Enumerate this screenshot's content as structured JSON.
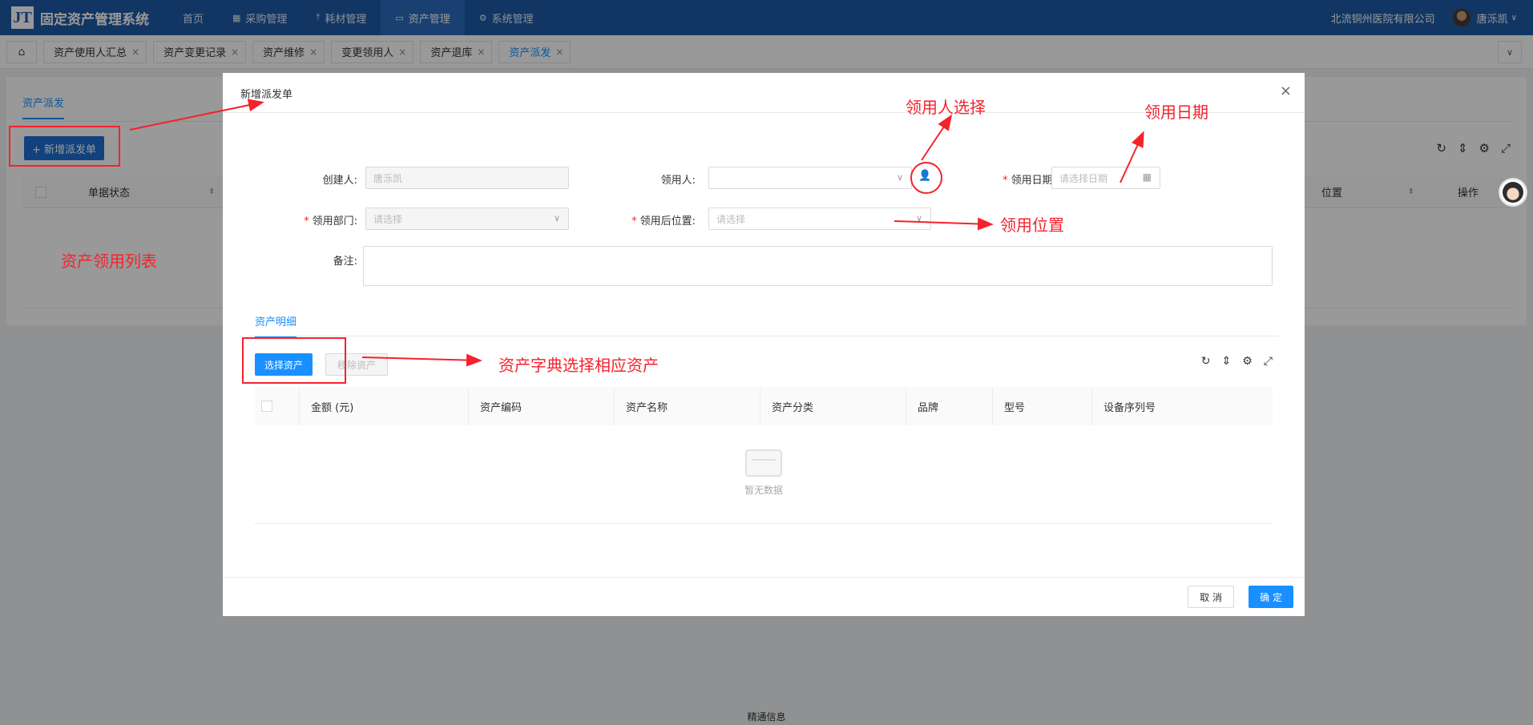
{
  "app": {
    "logo_mark": "JT",
    "title": "固定资产管理系统",
    "nav": [
      {
        "label": "首页",
        "icon": ""
      },
      {
        "label": "采购管理",
        "icon": "grid-icon"
      },
      {
        "label": "耗材管理",
        "icon": "upload-icon"
      },
      {
        "label": "资产管理",
        "icon": "calendar-icon",
        "active": true
      },
      {
        "label": "系统管理",
        "icon": "gear-icon"
      }
    ],
    "org": "北流铜州医院有限公司",
    "user": "唐泺凯",
    "footer": "精通信息"
  },
  "tabs": [
    "资产使用人汇总",
    "资产变更记录",
    "资产维修",
    "变更领用人",
    "资产退库",
    "资产派发"
  ],
  "page": {
    "tab": "资产派发",
    "new_button": "+ 新增派发单",
    "columns": {
      "status": "单据状态",
      "position": "位置",
      "action": "操作"
    }
  },
  "modal": {
    "title": "新增派发单",
    "fields": {
      "creator_label": "创建人:",
      "creator_value": "唐泺凯",
      "recipient_label": "领用人:",
      "date_label": "领用日期:",
      "date_placeholder": "请选择日期",
      "dept_label": "领用部门:",
      "dept_placeholder": "请选择",
      "location_label": "领用后位置:",
      "location_placeholder": "请选择",
      "remark_label": "备注:"
    },
    "detail_tab": "资产明细",
    "select_button": "选择资产",
    "remove_button": "移除资产",
    "columns": [
      "金额 (元)",
      "资产编码",
      "资产名称",
      "资产分类",
      "品牌",
      "型号",
      "设备序列号"
    ],
    "empty": "暂无数据",
    "cancel": "取 消",
    "ok": "确 定"
  },
  "annotations": {
    "recipient_select": "领用人选择",
    "recipient_date": "领用日期",
    "location": "领用位置",
    "list": "资产领用列表",
    "dict_select": "资产字典选择相应资产"
  },
  "colors": {
    "primary": "#1890ff",
    "nav": "#1d5aa7",
    "annotation": "#f5222d"
  }
}
